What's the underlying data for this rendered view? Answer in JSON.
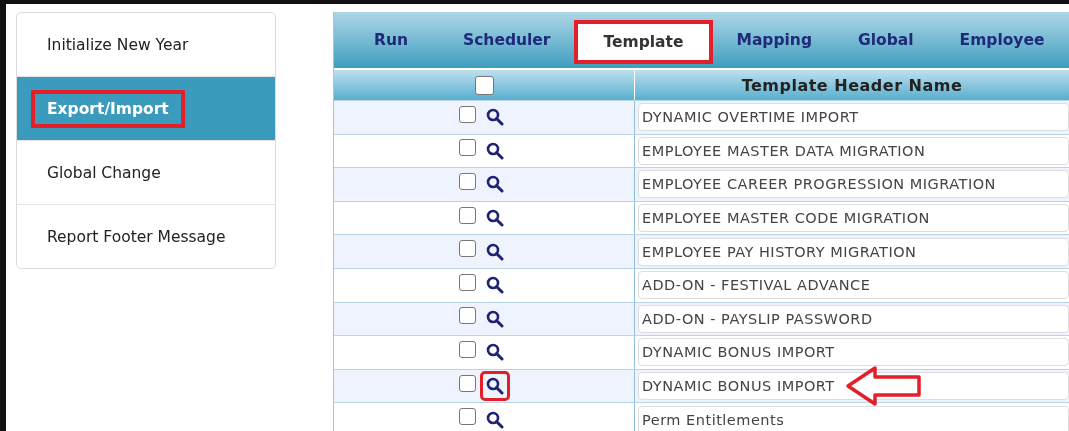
{
  "sidebar": {
    "items": [
      {
        "label": "Initialize New Year",
        "selected": false,
        "highlighted": false
      },
      {
        "label": "Export/Import",
        "selected": true,
        "highlighted": true
      },
      {
        "label": "Global Change",
        "selected": false,
        "highlighted": false
      },
      {
        "label": "Report Footer Message",
        "selected": false,
        "highlighted": false
      }
    ]
  },
  "tabs": [
    {
      "label": "Run",
      "selected": false,
      "highlighted": false
    },
    {
      "label": "Scheduler",
      "selected": false,
      "highlighted": false
    },
    {
      "label": "Template",
      "selected": true,
      "highlighted": true
    },
    {
      "label": "Mapping",
      "selected": false,
      "highlighted": false
    },
    {
      "label": "Global",
      "selected": false,
      "highlighted": false
    },
    {
      "label": "Employee",
      "selected": false,
      "highlighted": false
    }
  ],
  "table": {
    "header_checked": false,
    "columns": [
      "Template Header Name"
    ],
    "rows": [
      {
        "checked": false,
        "name": "DYNAMIC OVERTIME IMPORT",
        "icon_highlighted": false,
        "arrow": false
      },
      {
        "checked": false,
        "name": "EMPLOYEE MASTER DATA MIGRATION",
        "icon_highlighted": false,
        "arrow": false
      },
      {
        "checked": false,
        "name": "EMPLOYEE CAREER PROGRESSION MIGRATION",
        "icon_highlighted": false,
        "arrow": false
      },
      {
        "checked": false,
        "name": "EMPLOYEE MASTER CODE MIGRATION",
        "icon_highlighted": false,
        "arrow": false
      },
      {
        "checked": false,
        "name": "EMPLOYEE PAY HISTORY MIGRATION",
        "icon_highlighted": false,
        "arrow": false
      },
      {
        "checked": false,
        "name": "ADD-ON - FESTIVAL ADVANCE",
        "icon_highlighted": false,
        "arrow": false
      },
      {
        "checked": false,
        "name": "ADD-ON - PAYSLIP PASSWORD",
        "icon_highlighted": false,
        "arrow": false
      },
      {
        "checked": false,
        "name": "DYNAMIC BONUS IMPORT",
        "icon_highlighted": false,
        "arrow": false
      },
      {
        "checked": false,
        "name": "DYNAMIC BONUS IMPORT",
        "icon_highlighted": true,
        "arrow": true
      },
      {
        "checked": false,
        "name": "Perm Entitlements",
        "icon_highlighted": false,
        "arrow": false
      }
    ]
  }
}
